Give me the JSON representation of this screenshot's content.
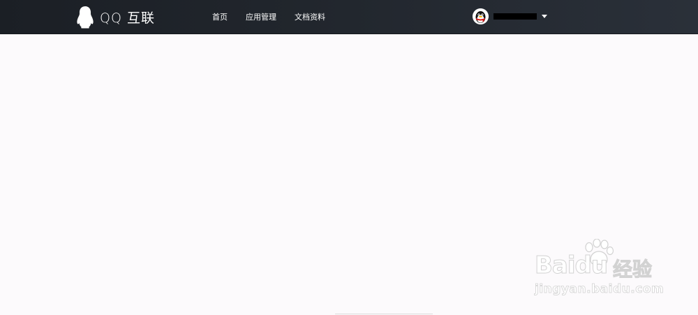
{
  "header": {
    "logo": {
      "text": "QQ 互联",
      "icon": "penguin-icon"
    },
    "nav": [
      {
        "label": "首页"
      },
      {
        "label": "应用管理"
      },
      {
        "label": "文档资料"
      }
    ],
    "user": {
      "avatar_icon": "qq-avatar-icon",
      "name": "",
      "menu_icon": "caret-down-icon"
    }
  },
  "watermark": {
    "brand": "Baidu",
    "product": "经验",
    "url": "jingyan.baidu.com"
  },
  "colors": {
    "navbar": "#22272e",
    "page_background": "#fcfafc",
    "nav_text": "#ffffff"
  }
}
